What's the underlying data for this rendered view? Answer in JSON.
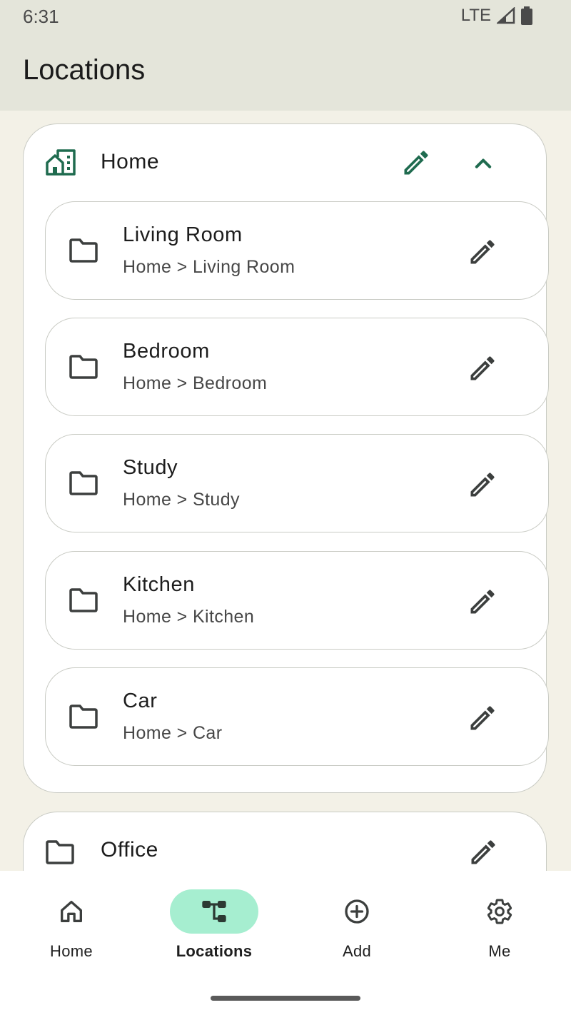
{
  "status_bar": {
    "time": "6:31",
    "network": "LTE"
  },
  "app_bar": {
    "title": "Locations"
  },
  "group": {
    "title": "Home",
    "icon": "house-building-icon",
    "items": [
      {
        "title": "Living Room",
        "path": "Home > Living Room"
      },
      {
        "title": "Bedroom",
        "path": "Home > Bedroom"
      },
      {
        "title": "Study",
        "path": "Home > Study"
      },
      {
        "title": "Kitchen",
        "path": "Home > Kitchen"
      },
      {
        "title": "Car",
        "path": "Home > Car"
      }
    ]
  },
  "office": {
    "title": "Office"
  },
  "nav": {
    "items": [
      {
        "label": "Home",
        "icon": "home-icon"
      },
      {
        "label": "Locations",
        "icon": "tree-icon"
      },
      {
        "label": "Add",
        "icon": "add-circle-icon"
      },
      {
        "label": "Me",
        "icon": "gear-icon"
      }
    ],
    "active": "Locations"
  },
  "colors": {
    "accent_green": "#1f6b4f",
    "active_pill": "#a6eed0",
    "background": "#f3f1e7",
    "app_bar": "#e4e5da"
  }
}
